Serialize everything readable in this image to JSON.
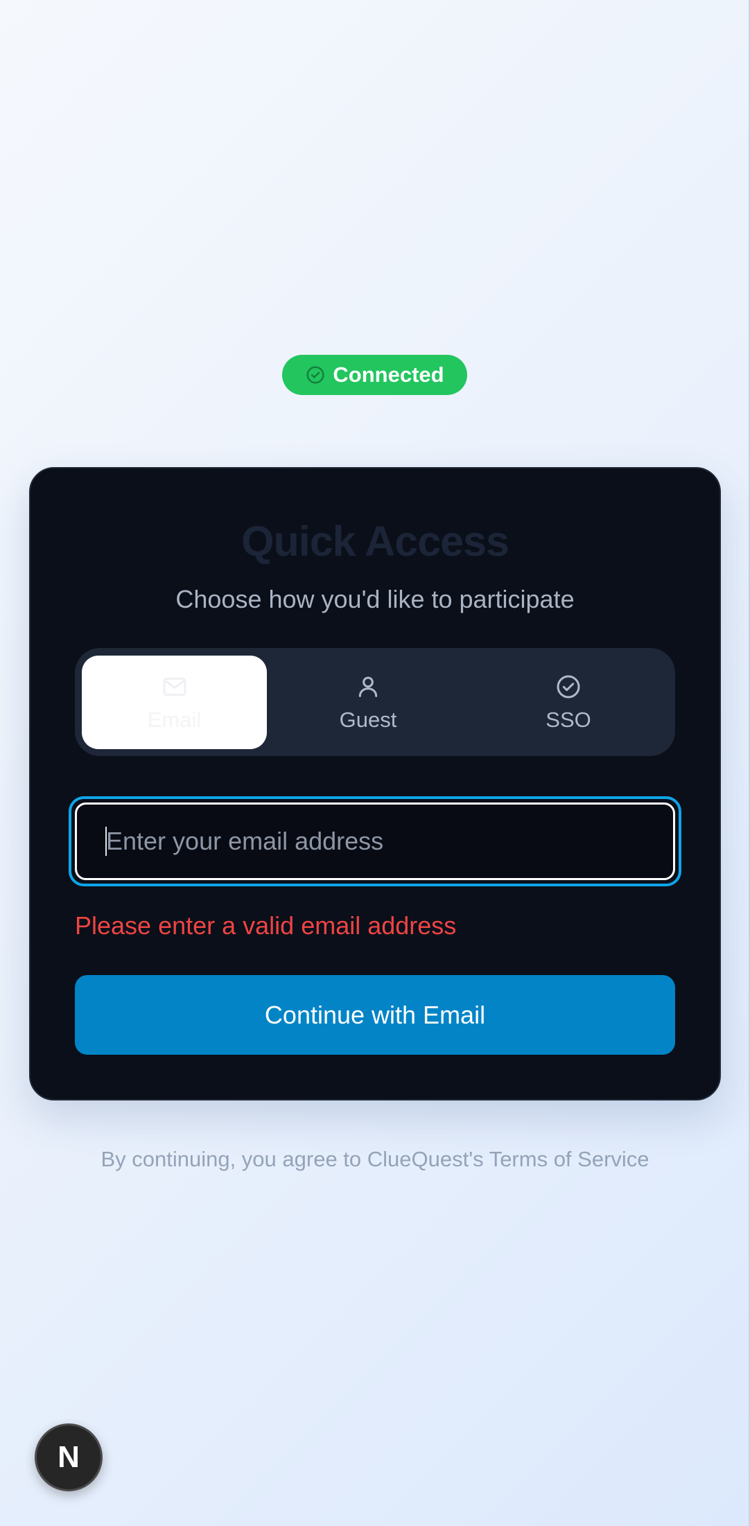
{
  "status": {
    "label": "Connected",
    "icon": "check-circle-icon",
    "color": "#22c55e"
  },
  "card": {
    "title": "Quick Access",
    "subtitle": "Choose how you'd like to participate"
  },
  "tabs": [
    {
      "label": "Email",
      "icon": "mail-icon",
      "selected": true
    },
    {
      "label": "Guest",
      "icon": "user-icon",
      "selected": false
    },
    {
      "label": "SSO",
      "icon": "check-circle-icon",
      "selected": false
    }
  ],
  "email": {
    "value": "",
    "placeholder": "Enter your email address",
    "error": "Please enter a valid email address"
  },
  "continue_label": "Continue with Email",
  "terms": "By continuing, you agree to ClueQuest's Terms of Service",
  "dev_badge": {
    "label": "N"
  },
  "colors": {
    "accent": "#0284c7",
    "focus_ring": "#0ea5e9",
    "error": "#ef4444",
    "card_background": "#0b0f19"
  }
}
